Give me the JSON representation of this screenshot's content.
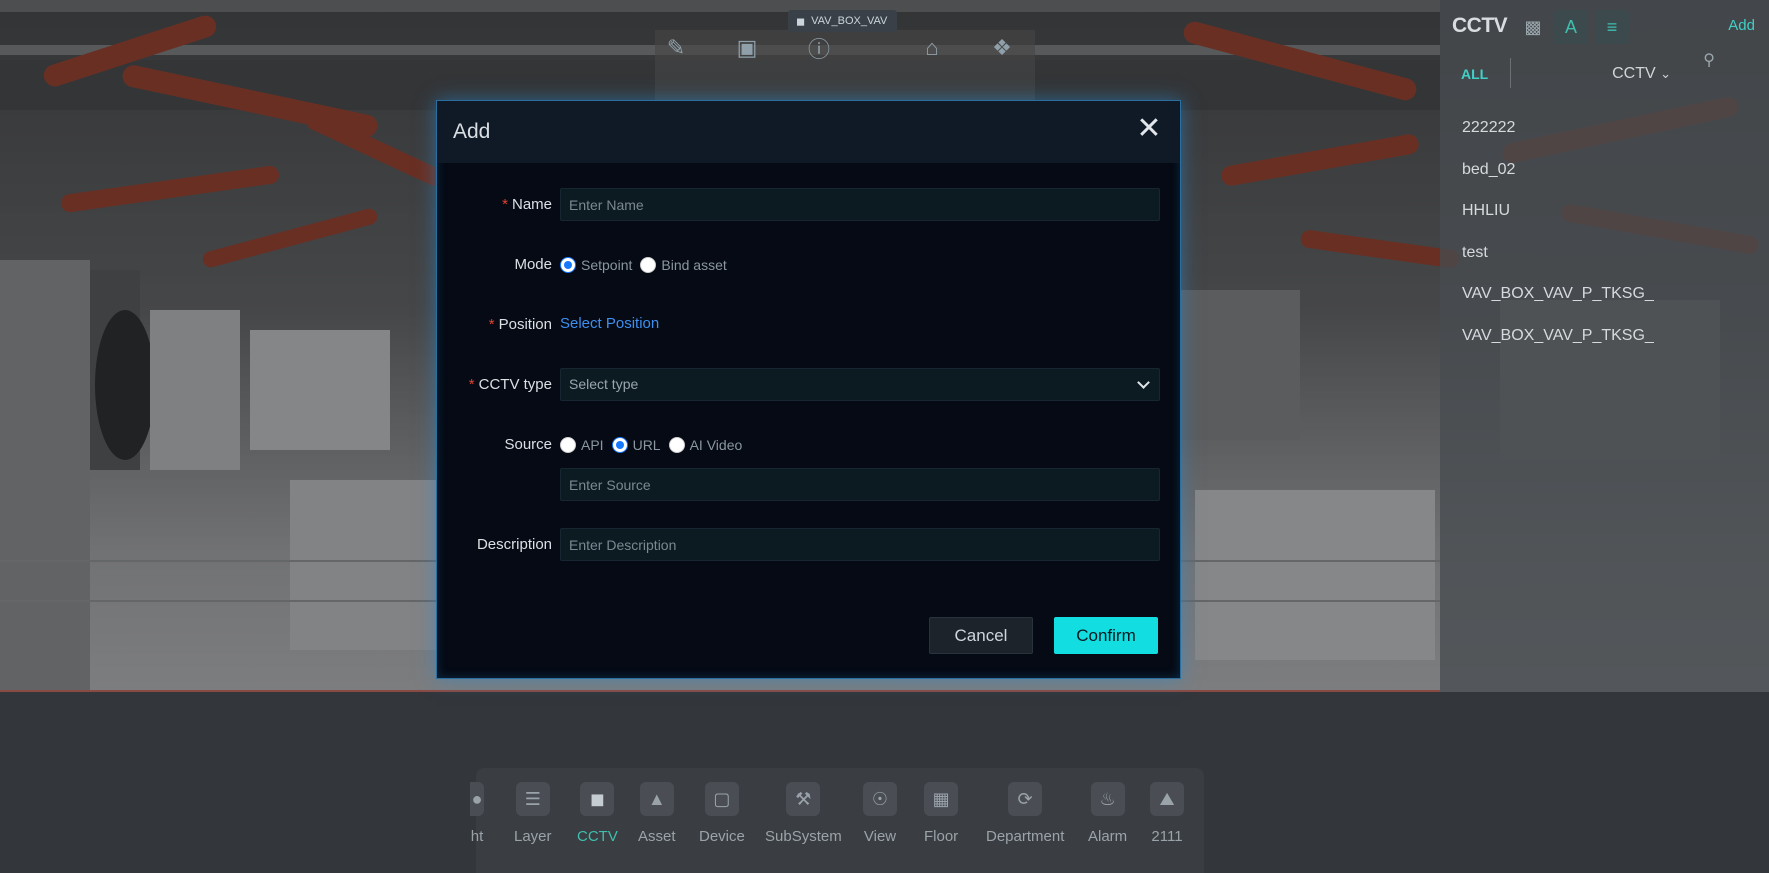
{
  "top_bar": {
    "label": "VAV_BOX_VAV",
    "tools": [
      "edit-icon",
      "box-icon",
      "info-icon",
      "home-icon",
      "cube-icon"
    ]
  },
  "right_panel": {
    "title": "CCTV",
    "add_label": "Add",
    "filter_all": "ALL",
    "filter_type": "CCTV",
    "items": [
      "222222",
      "bed_02",
      "HHLIU",
      "test",
      "VAV_BOX_VAV_P_TKSG_",
      "VAV_BOX_VAV_P_TKSG_"
    ]
  },
  "dock": {
    "items": [
      {
        "label": "ht",
        "icon": "light-icon"
      },
      {
        "label": "Layer",
        "icon": "layer-icon"
      },
      {
        "label": "CCTV",
        "icon": "cctv-icon",
        "active": true
      },
      {
        "label": "Asset",
        "icon": "asset-icon"
      },
      {
        "label": "Device",
        "icon": "device-icon"
      },
      {
        "label": "SubSystem",
        "icon": "subsystem-icon"
      },
      {
        "label": "View",
        "icon": "view-icon"
      },
      {
        "label": "Floor",
        "icon": "floor-icon"
      },
      {
        "label": "Department",
        "icon": "department-icon"
      },
      {
        "label": "Alarm",
        "icon": "alarm-icon"
      },
      {
        "label": "2111",
        "icon": "image-icon"
      }
    ]
  },
  "modal": {
    "title": "Add",
    "name_label": "Name",
    "name_placeholder": "Enter Name",
    "mode_label": "Mode",
    "mode_options": [
      "Setpoint",
      "Bind asset"
    ],
    "mode_selected": "Setpoint",
    "position_label": "Position",
    "position_link": "Select Position",
    "cctv_type_label": "CCTV type",
    "cctv_type_value": "Select type",
    "source_label": "Source",
    "source_options": [
      "API",
      "URL",
      "AI Video"
    ],
    "source_selected": "URL",
    "source_placeholder": "Enter Source",
    "description_label": "Description",
    "description_placeholder": "Enter Description",
    "cancel_label": "Cancel",
    "confirm_label": "Confirm"
  }
}
